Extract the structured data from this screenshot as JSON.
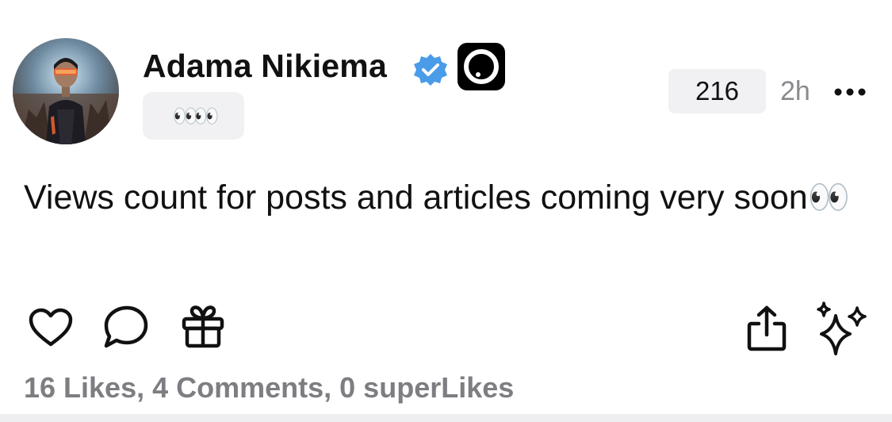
{
  "post": {
    "author": {
      "name": "Adama Nikiema",
      "verified": true,
      "status_emoji": "👀👀"
    },
    "view_count": "216",
    "timestamp": "2h",
    "text": "Views count for posts and articles coming very soon👀",
    "stats": "16 Likes, 4 Comments, 0 superLikes"
  },
  "icons": {
    "verified": "verified-badge-icon",
    "app_badge": "app-logo-icon",
    "more": "more-horizontal-icon",
    "like": "heart-icon",
    "comment": "comment-bubble-icon",
    "gift": "gift-icon",
    "share": "share-icon",
    "superlike": "sparkles-icon"
  },
  "colors": {
    "verified": "#4a9be8",
    "chip_bg": "#f1f1f4",
    "muted_text": "#8a8a8e",
    "stats_text": "#7d7d82"
  }
}
